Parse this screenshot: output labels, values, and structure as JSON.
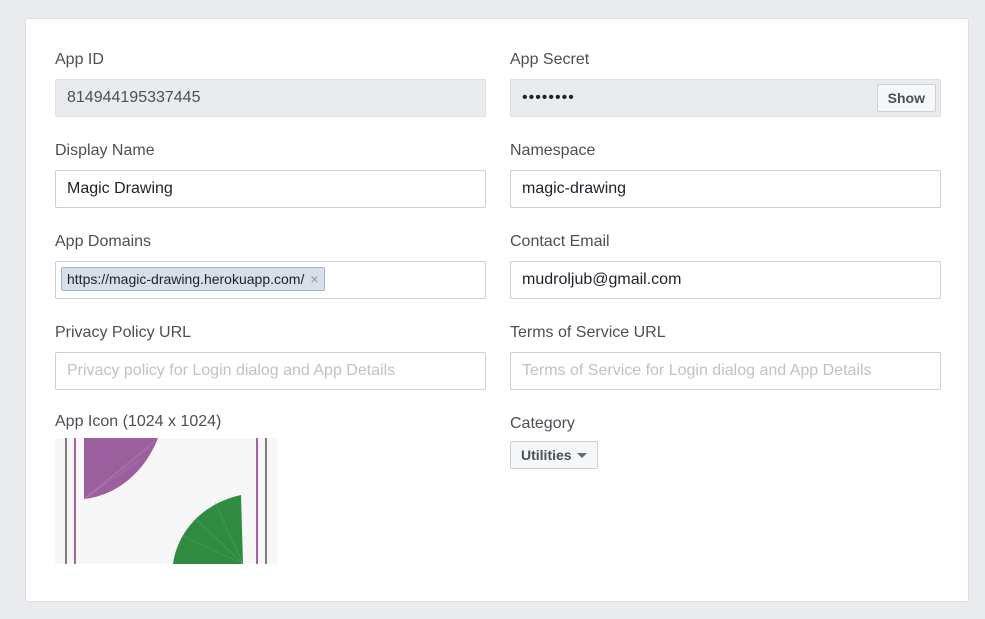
{
  "app_id": {
    "label": "App ID",
    "value": "814944195337445"
  },
  "app_secret": {
    "label": "App Secret",
    "masked_value": "••••••••",
    "show_label": "Show"
  },
  "display_name": {
    "label": "Display Name",
    "value": "Magic Drawing"
  },
  "namespace": {
    "label": "Namespace",
    "value": "magic-drawing"
  },
  "app_domains": {
    "label": "App Domains",
    "tokens": [
      "https://magic-drawing.herokuapp.com/"
    ],
    "remove_glyph": "×"
  },
  "contact_email": {
    "label": "Contact Email",
    "value": "mudroljub@gmail.com"
  },
  "privacy_policy": {
    "label": "Privacy Policy URL",
    "placeholder": "Privacy policy for Login dialog and App Details"
  },
  "terms_of_service": {
    "label": "Terms of Service URL",
    "placeholder": "Terms of Service for Login dialog and App Details"
  },
  "app_icon": {
    "label": "App Icon (1024 x 1024)"
  },
  "category": {
    "label": "Category",
    "selected": "Utilities"
  },
  "colors": {
    "page_bg": "#e9ebee",
    "panel_bg": "#ffffff",
    "token_bg": "#d8dfea",
    "icon_purple": "#9b5f9e",
    "icon_green": "#2e8b40"
  }
}
